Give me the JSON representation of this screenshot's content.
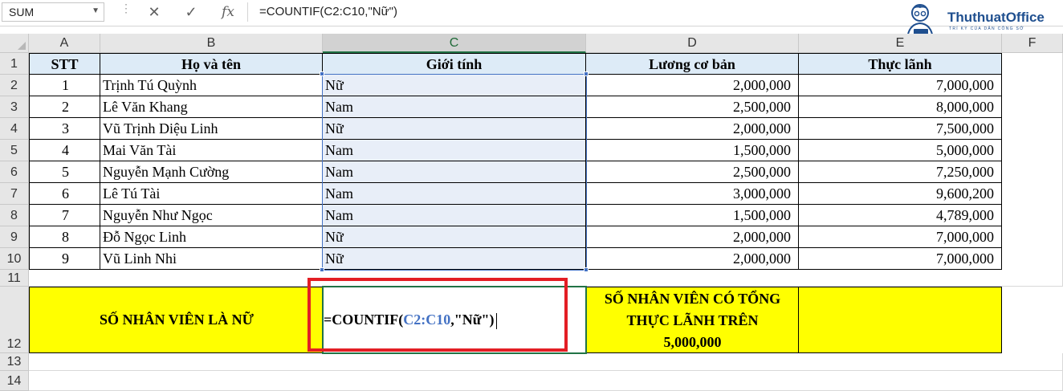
{
  "formula_bar": {
    "name_box": "SUM",
    "formula": "=COUNTIF(C2:C10,\"Nữ\")"
  },
  "logo": {
    "brand": "ThuthuatOffice",
    "tagline": "TRÍ KỲ CỦA DÂN CÔNG SỞ"
  },
  "columns": [
    "A",
    "B",
    "C",
    "D",
    "E",
    "F"
  ],
  "row_numbers": [
    "1",
    "2",
    "3",
    "4",
    "5",
    "6",
    "7",
    "8",
    "9",
    "10",
    "11",
    "12",
    "13",
    "14"
  ],
  "table": {
    "headers": {
      "stt": "STT",
      "name": "Họ và tên",
      "gender": "Giới tính",
      "base_salary": "Lương cơ bản",
      "net_salary": "Thực lãnh"
    },
    "rows": [
      {
        "stt": "1",
        "name": "Trịnh Tú Quỳnh",
        "gender": "Nữ",
        "base_salary": "2,000,000",
        "net_salary": "7,000,000"
      },
      {
        "stt": "2",
        "name": "Lê Văn Khang",
        "gender": "Nam",
        "base_salary": "2,500,000",
        "net_salary": "8,000,000"
      },
      {
        "stt": "3",
        "name": "Vũ Trịnh Diệu Linh",
        "gender": "Nữ",
        "base_salary": "2,000,000",
        "net_salary": "7,500,000"
      },
      {
        "stt": "4",
        "name": "Mai Văn Tài",
        "gender": "Nam",
        "base_salary": "1,500,000",
        "net_salary": "5,000,000"
      },
      {
        "stt": "5",
        "name": "Nguyễn Mạnh Cường",
        "gender": "Nam",
        "base_salary": "2,500,000",
        "net_salary": "7,250,000"
      },
      {
        "stt": "6",
        "name": "Lê Tú Tài",
        "gender": "Nam",
        "base_salary": "3,000,000",
        "net_salary": "9,600,200"
      },
      {
        "stt": "7",
        "name": "Nguyễn Như Ngọc",
        "gender": "Nam",
        "base_salary": "1,500,000",
        "net_salary": "4,789,000"
      },
      {
        "stt": "8",
        "name": "Đỗ Ngọc Linh",
        "gender": "Nữ",
        "base_salary": "2,000,000",
        "net_salary": "7,000,000"
      },
      {
        "stt": "9",
        "name": "Vũ Linh Nhi",
        "gender": "Nữ",
        "base_salary": "2,000,000",
        "net_salary": "7,000,000"
      }
    ]
  },
  "summary": {
    "female_count_label": "SỐ NHÂN VIÊN LÀ NỮ",
    "formula_prefix": "=COUNTIF(",
    "formula_range": "C2:C10",
    "formula_suffix": ",\"Nữ\")",
    "high_pay_label_line1": "SỐ NHÂN VIÊN CÓ TỔNG",
    "high_pay_label_line2": "THỰC LÃNH TRÊN",
    "high_pay_label_line3": "5,000,000"
  },
  "colors": {
    "header_fill": "#ddebf7",
    "summary_fill": "#ffff00",
    "highlight_border": "#e31e24",
    "range_reference": "#4472c4",
    "active_cell": "#217346"
  }
}
